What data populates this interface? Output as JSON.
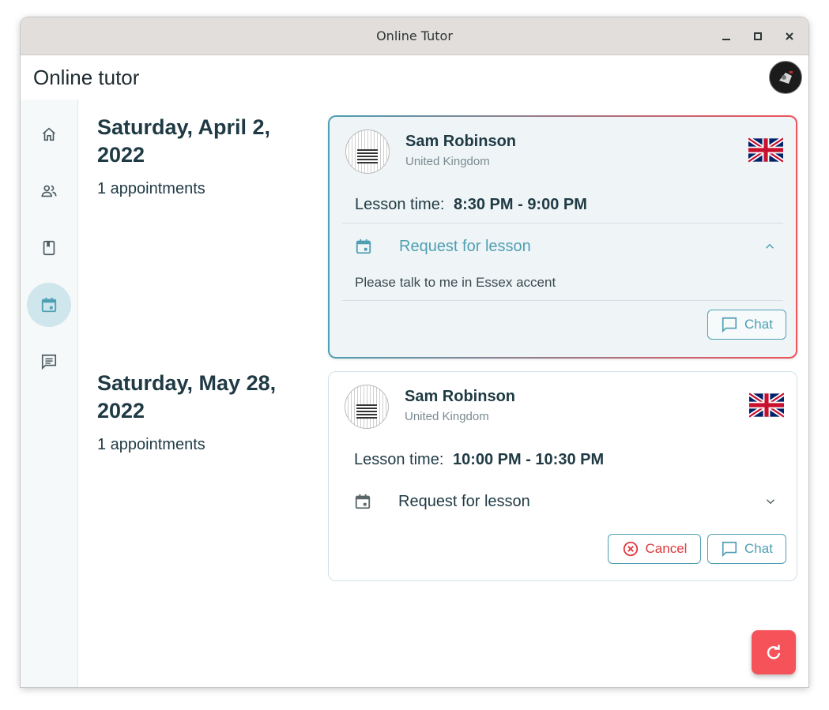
{
  "window": {
    "title": "Online Tutor"
  },
  "appbar": {
    "title": "Online tutor"
  },
  "nav": {
    "items": [
      {
        "name": "home",
        "icon": "home-icon"
      },
      {
        "name": "tutors",
        "icon": "people-icon"
      },
      {
        "name": "courses",
        "icon": "book-icon"
      },
      {
        "name": "schedule",
        "icon": "calendar-icon",
        "active": true
      },
      {
        "name": "messages",
        "icon": "chat-bubble-icon"
      }
    ]
  },
  "groups": [
    {
      "date": "Saturday, April 2, 2022",
      "count": "1 appointments",
      "card": {
        "tutor_name": "Sam Robinson",
        "country": "United Kingdom",
        "lesson_time_label": "Lesson time:",
        "lesson_time": "8:30 PM - 9:00 PM",
        "request_label": "Request for lesson",
        "request_note": "Please talk to me in Essex accent",
        "chat_label": "Chat",
        "expanded": true
      }
    },
    {
      "date": "Saturday, May 28, 2022",
      "count": "1 appointments",
      "card": {
        "tutor_name": "Sam Robinson",
        "country": "United Kingdom",
        "lesson_time_label": "Lesson time:",
        "lesson_time": "10:00 PM - 10:30 PM",
        "request_label": "Request for lesson",
        "cancel_label": "Cancel",
        "chat_label": "Chat",
        "expanded": false
      }
    }
  ],
  "colors": {
    "accent": "#4f9fb3",
    "danger": "#e0393e",
    "fab": "#f5525a",
    "text": "#1f3a44"
  }
}
